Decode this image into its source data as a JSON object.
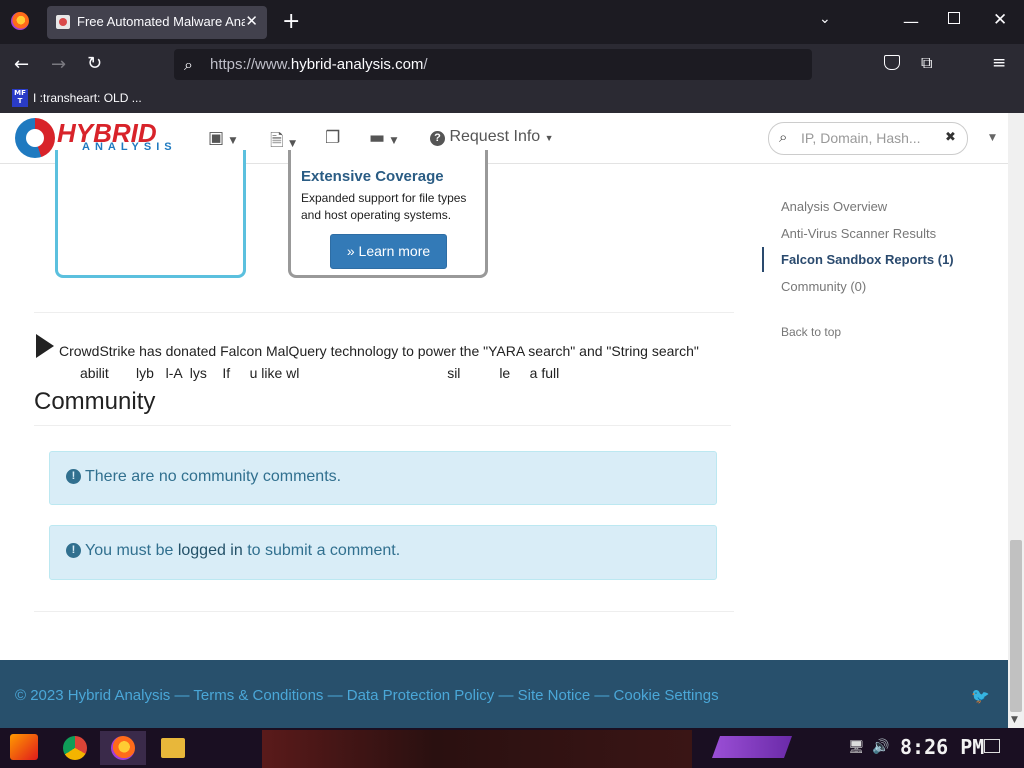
{
  "browser": {
    "tab_title": "Free Automated Malware Analysis",
    "tab_close": "✕",
    "new_tab": "+",
    "url_prefix": "https://www.",
    "url_domain": "hybrid-analysis.com",
    "url_suffix": "/",
    "bookmark_label": "I :transheart: OLD ...",
    "bookmark_icon_text": "MF T"
  },
  "site": {
    "logo_word1": "HYBRID",
    "logo_word2": "ANALYSIS",
    "nav_request_info": "Request Info",
    "search_placeholder": "IP, Domain, Hash..."
  },
  "feature_card": {
    "title": "Extensive Coverage",
    "description": "Expanded support for file types and host operating systems.",
    "button_label": "Learn more"
  },
  "notice": {
    "line1": "CrowdStrike has donated Falcon MalQuery technology to power the \"YARA search\" and \"String search\"",
    "line2": "abilit       lyb   l-A  lys    If     u like wl                                      sil          le     a full"
  },
  "community": {
    "heading": "Community",
    "alert_no_comments": "There are no community comments.",
    "alert_login_prefix": "You must be ",
    "alert_login_link": "logged in",
    "alert_login_suffix": " to submit a comment."
  },
  "sidebar": {
    "items": [
      {
        "label": "Analysis Overview"
      },
      {
        "label": "Anti-Virus Scanner Results"
      },
      {
        "label": "Falcon Sandbox Reports (1)"
      },
      {
        "label": "Community (0)"
      }
    ],
    "back_to_top": "Back to top"
  },
  "footer": {
    "text": "© 2023 Hybrid Analysis — Terms & Conditions — Data Protection Policy — Site Notice — Cookie Settings"
  },
  "taskbar": {
    "clock": "8:26 PM"
  },
  "colors": {
    "accent": "#337ab7",
    "footer_bg": "#28506c",
    "alert_bg": "#d9edf7"
  }
}
